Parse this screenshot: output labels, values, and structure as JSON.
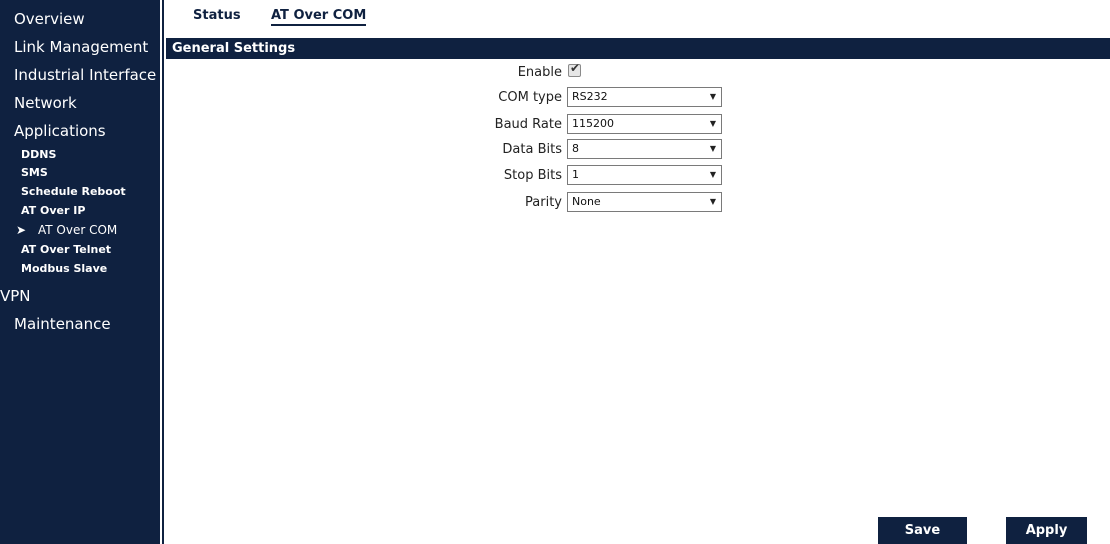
{
  "sidebar": {
    "items": [
      {
        "label": "Overview"
      },
      {
        "label": "Link Management"
      },
      {
        "label": "Industrial Interface"
      },
      {
        "label": "Network"
      },
      {
        "label": "Applications"
      }
    ],
    "sub_items": [
      {
        "label": "DDNS"
      },
      {
        "label": "SMS"
      },
      {
        "label": "Schedule Reboot"
      },
      {
        "label": "AT Over IP"
      },
      {
        "label": "AT Over COM",
        "active": true
      },
      {
        "label": "AT Over Telnet"
      },
      {
        "label": "Modbus Slave"
      }
    ],
    "bottom_items": [
      {
        "label": "VPN"
      },
      {
        "label": "Maintenance"
      }
    ],
    "active_marker_icon": "arrow-right-icon"
  },
  "tabs": [
    {
      "label": "Status"
    },
    {
      "label": "AT Over COM",
      "active": true
    }
  ],
  "section": {
    "title": "General Settings"
  },
  "form": {
    "enable": {
      "label": "Enable",
      "checked": true
    },
    "com_type": {
      "label": "COM type",
      "value": "RS232"
    },
    "baud_rate": {
      "label": "Baud Rate",
      "value": "115200"
    },
    "data_bits": {
      "label": "Data Bits",
      "value": "8"
    },
    "stop_bits": {
      "label": "Stop Bits",
      "value": "1"
    },
    "parity": {
      "label": "Parity",
      "value": "None"
    }
  },
  "buttons": {
    "save": "Save",
    "apply": "Apply"
  },
  "colors": {
    "navy": "#0f2140",
    "text": "#222222"
  }
}
